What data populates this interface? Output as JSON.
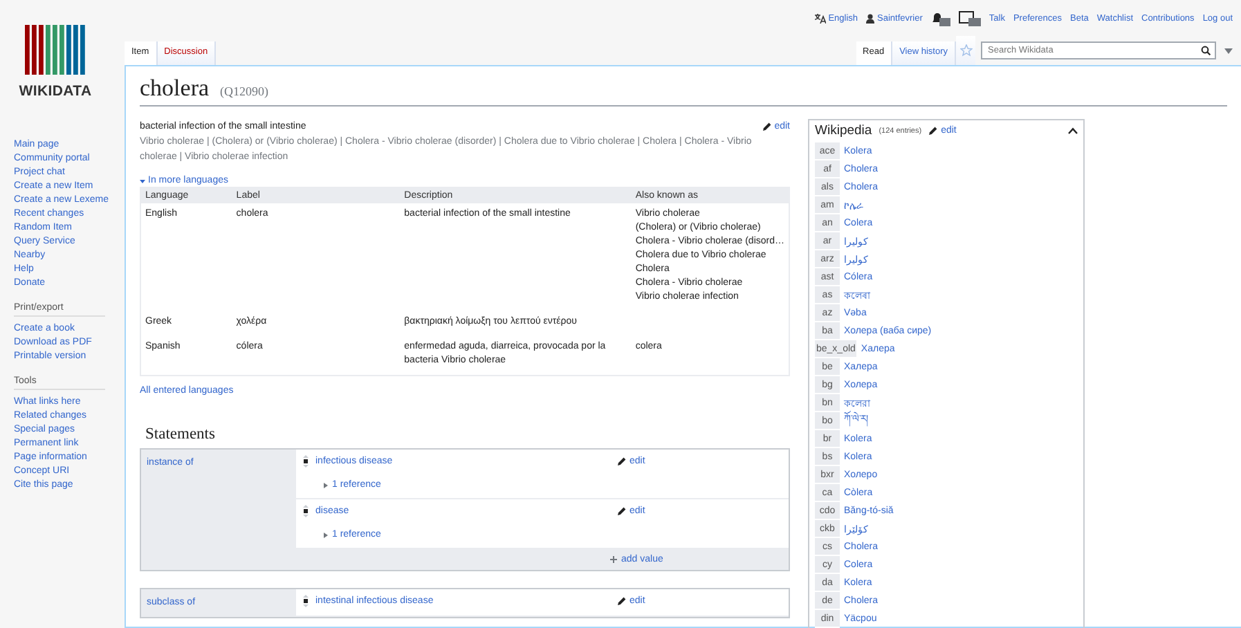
{
  "logo": {
    "wordmark": "WIKIDATA"
  },
  "personal_tools": [
    {
      "label": "English",
      "kind": "language"
    },
    {
      "label": "Saintfevrier",
      "kind": "user"
    },
    {
      "label": "Talk",
      "kind": "link"
    },
    {
      "label": "Preferences",
      "kind": "link"
    },
    {
      "label": "Beta",
      "kind": "link"
    },
    {
      "label": "Watchlist",
      "kind": "link"
    },
    {
      "label": "Contributions",
      "kind": "link"
    },
    {
      "label": "Log out",
      "kind": "link"
    }
  ],
  "sidebar": {
    "sections": [
      {
        "items": [
          "Main page",
          "Community portal",
          "Project chat",
          "Create a new Item",
          "Create a new Lexeme",
          "Recent changes",
          "Random Item",
          "Query Service",
          "Nearby",
          "Help",
          "Donate"
        ]
      },
      {
        "heading": "Print/export",
        "items": [
          "Create a book",
          "Download as PDF",
          "Printable version"
        ]
      },
      {
        "heading": "Tools",
        "items": [
          "What links here",
          "Related changes",
          "Special pages",
          "Permanent link",
          "Page information",
          "Concept URI",
          "Cite this page"
        ]
      }
    ]
  },
  "tabs_left": [
    {
      "label": "Item",
      "selected": true,
      "missing": false
    },
    {
      "label": "Discussion",
      "selected": false,
      "missing": true
    }
  ],
  "tabs_right": [
    {
      "label": "Read",
      "selected": true
    },
    {
      "label": "View history",
      "selected": false
    }
  ],
  "watched": false,
  "search": {
    "placeholder": "Search Wikidata"
  },
  "item": {
    "label": "cholera",
    "id": "(Q12090)",
    "description": "bacterial infection of the small intestine",
    "edit": "edit",
    "aliases": "Vibrio cholerae | (Cholera) or (Vibrio cholerae) | Cholera - Vibrio cholerae (disorder) | Cholera due to Vibrio cholerae | Cholera | Cholera - Vibrio cholerae | Vibrio cholerae infection"
  },
  "terms": {
    "toggle": "In more languages",
    "expanded": true,
    "columns": [
      "Language",
      "Label",
      "Description",
      "Also known as"
    ],
    "rows": [
      {
        "language": "English",
        "label": "cholera",
        "description": "bacterial infection of the small intestine",
        "aliases": [
          "Vibrio cholerae",
          "(Cholera) or (Vibrio cholerae)",
          "Cholera - Vibrio cholerae (disord…",
          "Cholera due to Vibrio cholerae",
          "Cholera",
          "Cholera - Vibrio cholerae",
          "Vibrio cholerae infection"
        ]
      },
      {
        "language": "Greek",
        "label": "χολέρα",
        "description": "βακτηριακή λοίμωξη του λεπτού εντέρου",
        "aliases": []
      },
      {
        "language": "Spanish",
        "label": "cólera",
        "description": "enfermedad aguda, diarreica, provocada por la bacteria Vibrio cholerae",
        "aliases": [
          "colera"
        ]
      }
    ],
    "all_link": "All entered languages"
  },
  "statements": {
    "heading": "Statements",
    "groups": [
      {
        "property": "instance of",
        "add": "add value",
        "values": [
          {
            "value": "infectious disease",
            "edit": "edit",
            "references": "1 reference"
          },
          {
            "value": "disease",
            "edit": "edit",
            "references": "1 reference"
          }
        ]
      },
      {
        "property": "subclass of",
        "values": [
          {
            "value": "intestinal infectious disease",
            "edit": "edit"
          }
        ]
      }
    ]
  },
  "sitelinks": {
    "title": "Wikipedia",
    "count": "(124 entries)",
    "edit": "edit",
    "expanded": true,
    "links": [
      {
        "code": "ace",
        "title": "Kolera"
      },
      {
        "code": "af",
        "title": "Cholera"
      },
      {
        "code": "als",
        "title": "Cholera"
      },
      {
        "code": "am",
        "title": "ኮሌራ"
      },
      {
        "code": "an",
        "title": "Colera"
      },
      {
        "code": "ar",
        "title": "كوليرا"
      },
      {
        "code": "arz",
        "title": "كوليرا"
      },
      {
        "code": "ast",
        "title": "Cólera"
      },
      {
        "code": "as",
        "title": "কলেৰা"
      },
      {
        "code": "az",
        "title": "Vəba"
      },
      {
        "code": "ba",
        "title": "Холера (ваба сире)"
      },
      {
        "code": "be_x_old",
        "title": "Халера"
      },
      {
        "code": "be",
        "title": "Халера"
      },
      {
        "code": "bg",
        "title": "Холера"
      },
      {
        "code": "bn",
        "title": "কলেরা"
      },
      {
        "code": "bo",
        "title": "ཀོ་ལེ་ར།"
      },
      {
        "code": "br",
        "title": "Kolera"
      },
      {
        "code": "bs",
        "title": "Kolera"
      },
      {
        "code": "bxr",
        "title": "Холеро"
      },
      {
        "code": "ca",
        "title": "Còlera"
      },
      {
        "code": "cdo",
        "title": "Băng-tó-siă"
      },
      {
        "code": "ckb",
        "title": "کۆلێرا"
      },
      {
        "code": "cs",
        "title": "Cholera"
      },
      {
        "code": "cy",
        "title": "Colera"
      },
      {
        "code": "da",
        "title": "Kolera"
      },
      {
        "code": "de",
        "title": "Cholera"
      },
      {
        "code": "din",
        "title": "Yäcpou"
      }
    ]
  }
}
